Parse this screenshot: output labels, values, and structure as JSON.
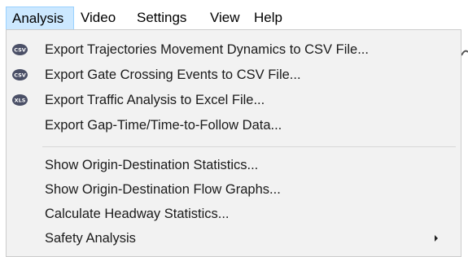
{
  "menubar": {
    "items": [
      {
        "label": "Analysis",
        "active": true
      },
      {
        "label": "Video"
      },
      {
        "label": "Settings"
      },
      {
        "label": "View"
      },
      {
        "label": "Help"
      }
    ]
  },
  "dropdown": {
    "items": [
      {
        "label": "Export Trajectories Movement Dynamics to CSV File...",
        "icon": "csv-file-icon",
        "icon_text": "CSV"
      },
      {
        "label": "Export Gate Crossing Events to CSV File...",
        "icon": "csv-file-icon",
        "icon_text": "CSV"
      },
      {
        "label": "Export Traffic Analysis to Excel File...",
        "icon": "xls-file-icon",
        "icon_text": "XLS"
      },
      {
        "label": "Export Gap-Time/Time-to-Follow Data..."
      },
      {
        "label": "Show Origin-Destination Statistics..."
      },
      {
        "label": "Show Origin-Destination Flow Graphs..."
      },
      {
        "label": "Calculate Headway Statistics..."
      },
      {
        "label": "Safety Analysis",
        "has_submenu": true
      }
    ]
  },
  "colors": {
    "menubar_active_bg": "#cce8ff",
    "menubar_active_border": "#99d1ff",
    "dropdown_bg": "#f2f2f2",
    "icon_dark": "#4a4f66",
    "icon_text": "#ffffff"
  }
}
